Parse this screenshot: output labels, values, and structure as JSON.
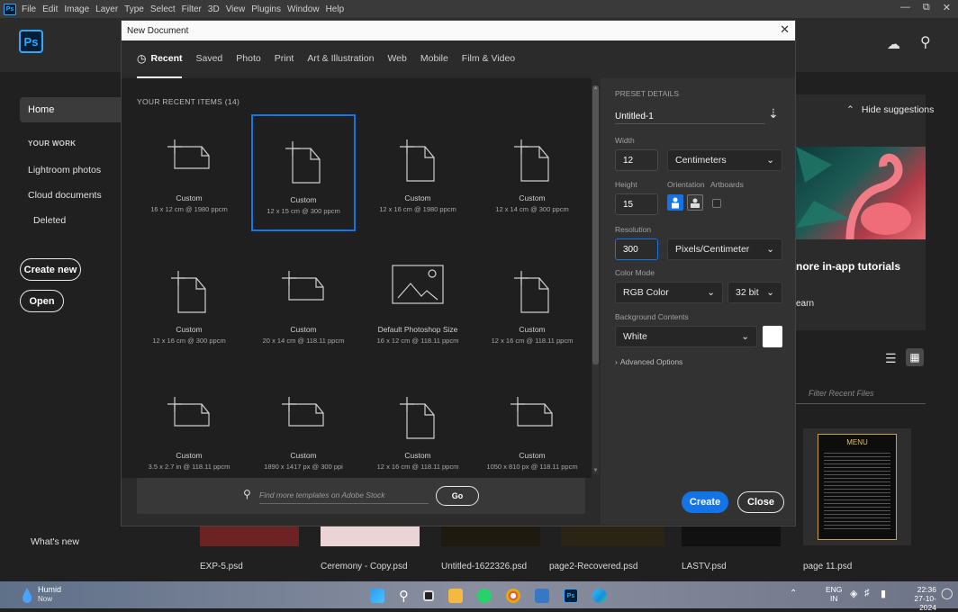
{
  "menubar": {
    "items": [
      "File",
      "Edit",
      "Image",
      "Layer",
      "Type",
      "Select",
      "Filter",
      "3D",
      "View",
      "Plugins",
      "Window",
      "Help"
    ]
  },
  "home": {
    "logo": "Ps",
    "sidebar": {
      "home": "Home",
      "your_work": "YOUR WORK",
      "lightroom": "Lightroom photos",
      "cloud_docs": "Cloud documents",
      "deleted": "Deleted",
      "create_new": "Create new",
      "open": "Open",
      "whats_new": "What's new"
    },
    "hide_suggestions": "Hide suggestions",
    "tutorials_text": "nore in-app tutorials",
    "learn_text": "earn",
    "filter_placeholder": "Filter Recent Files",
    "recent_files": [
      "EXP-5.psd",
      "Ceremony - Copy.psd",
      "Untitled-1622326.psd",
      "page2-Recovered.psd",
      "LASTV.psd",
      "page 11.psd"
    ],
    "menu_thumb_title": "MENU"
  },
  "dialog": {
    "title": "New Document",
    "tabs": [
      "Recent",
      "Saved",
      "Photo",
      "Print",
      "Art & Illustration",
      "Web",
      "Mobile",
      "Film & Video"
    ],
    "recent_header": "YOUR RECENT ITEMS  (14)",
    "items": [
      {
        "name": "Custom",
        "sub": "16 x 12 cm @ 1980 ppcm",
        "shape": "landscape"
      },
      {
        "name": "Custom",
        "sub": "12 x 15 cm @ 300 ppcm",
        "shape": "portrait"
      },
      {
        "name": "Custom",
        "sub": "12 x 16 cm @ 1980 ppcm",
        "shape": "portrait"
      },
      {
        "name": "Custom",
        "sub": "12 x 14 cm @ 300 ppcm",
        "shape": "portrait"
      },
      {
        "name": "Custom",
        "sub": "12 x 16 cm @ 300 ppcm",
        "shape": "portrait"
      },
      {
        "name": "Custom",
        "sub": "20 x 14 cm @ 118.11 ppcm",
        "shape": "landscape"
      },
      {
        "name": "Default Photoshop Size",
        "sub": "16 x 12 cm @ 118.11 ppcm",
        "shape": "image"
      },
      {
        "name": "Custom",
        "sub": "12 x 16 cm @ 118.11 ppcm",
        "shape": "portrait"
      },
      {
        "name": "Custom",
        "sub": "3.5 x 2.7 in @ 118.11 ppcm",
        "shape": "landscape"
      },
      {
        "name": "Custom",
        "sub": "1890 x 1417 px @ 300 ppi",
        "shape": "landscape"
      },
      {
        "name": "Custom",
        "sub": "12 x 16 cm @ 118.11 ppcm",
        "shape": "portrait"
      },
      {
        "name": "Custom",
        "sub": "1050 x 810 px @ 118.11 ppcm",
        "shape": "landscape"
      }
    ],
    "search_placeholder": "Find more templates on Adobe Stock",
    "go": "Go",
    "preset": {
      "header": "PRESET DETAILS",
      "name": "Untitled-1",
      "width_label": "Width",
      "width": "12",
      "unit": "Centimeters",
      "height_label": "Height",
      "height": "15",
      "orientation_label": "Orientation",
      "artboards_label": "Artboards",
      "resolution_label": "Resolution",
      "resolution": "300",
      "res_unit": "Pixels/Centimeter",
      "color_mode_label": "Color Mode",
      "color_mode": "RGB Color",
      "bit_depth": "32 bit",
      "bg_label": "Background Contents",
      "bg": "White",
      "advanced": "Advanced Options",
      "create": "Create",
      "close": "Close"
    }
  },
  "taskbar": {
    "weather": "Humid",
    "weather_sub": "Now",
    "lang": "ENG",
    "lang_sub": "IN",
    "time": "22:36",
    "date": "27-10-2024"
  }
}
